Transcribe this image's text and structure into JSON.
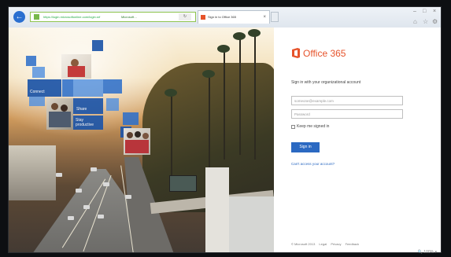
{
  "browser": {
    "address_url": "https://login.microsoftonline.com/login.srf",
    "site_identity": "Microsoft…",
    "tab_title": "Sign in to Office 365",
    "close_glyph": "×",
    "back_glyph": "←",
    "minimize_glyph": "–",
    "maximize_glyph": "□",
    "window_close_glyph": "×",
    "home_glyph": "⌂",
    "favorites_glyph": "☆",
    "tools_glyph": "⚙"
  },
  "left_panel": {
    "tiles": [
      "Connect",
      "Share",
      "Stay productive"
    ]
  },
  "signin": {
    "brand": "Office 365",
    "brand_color": "#e6532b",
    "heading": "Sign in with your organizational account",
    "username_placeholder": "someone@example.com",
    "password_placeholder": "Password",
    "keep_signed_in": "Keep me signed in",
    "signin_button": "Sign in",
    "help_link": "Can't access your account?",
    "footer": {
      "copyright": "© Microsoft 2013",
      "links": [
        "Legal",
        "Privacy",
        "Feedback"
      ]
    }
  },
  "status_bar": {
    "zoom": "100%"
  }
}
